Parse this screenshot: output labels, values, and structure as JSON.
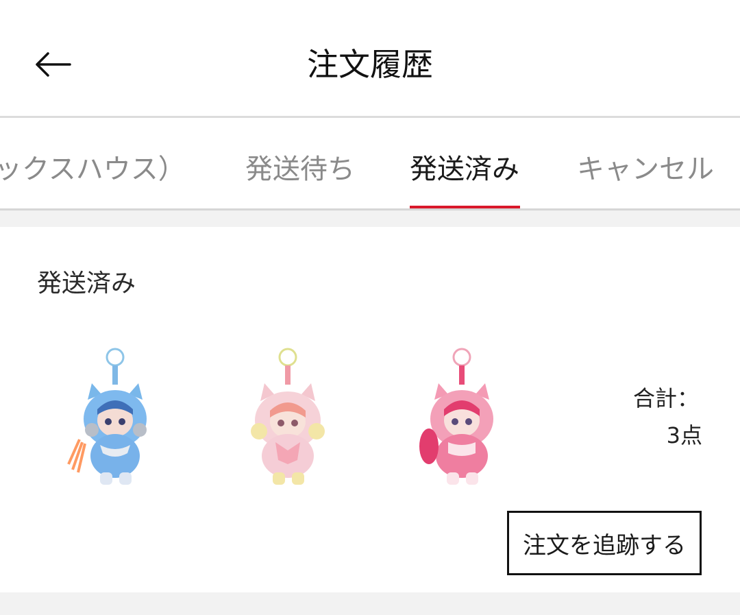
{
  "header": {
    "title": "注文履歴",
    "back_icon": "arrow-left-icon"
  },
  "tabs": [
    {
      "label": "ックスハウス）",
      "active": false
    },
    {
      "label": "発送待ち",
      "active": false
    },
    {
      "label": "発送済み",
      "active": true
    },
    {
      "label": "キャンセル",
      "active": false
    }
  ],
  "colors": {
    "accent": "#d9182b",
    "divider": "#dcdcdc",
    "section_bg": "#f2f2f2"
  },
  "order": {
    "status": "発送済み",
    "items": [
      {
        "name": "blue-plush-keychain"
      },
      {
        "name": "yellow-pink-plush-keychain"
      },
      {
        "name": "pink-plush-keychain"
      }
    ],
    "total_label": "合計：",
    "total_count": "3点",
    "track_button": "注文を追跡する"
  }
}
